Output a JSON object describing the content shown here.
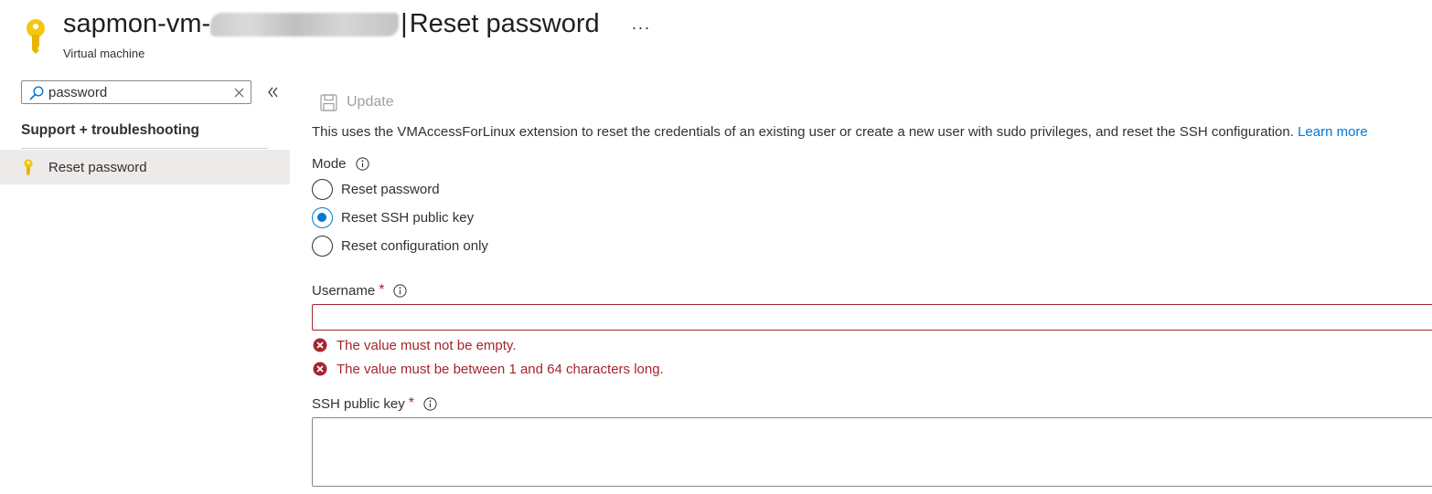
{
  "header": {
    "title_prefix": "sapmon-vm-",
    "title_separator": "|",
    "page_title": "Reset password",
    "subtitle": "Virtual machine",
    "more_label": "···"
  },
  "sidebar": {
    "search": {
      "value": "password",
      "placeholder": "Search"
    },
    "group_label": "Support + troubleshooting",
    "items": [
      {
        "label": "Reset password",
        "icon": "key-icon",
        "selected": true
      }
    ]
  },
  "toolbar": {
    "update_label": "Update"
  },
  "main": {
    "description": "This uses the VMAccessForLinux extension to reset the credentials of an existing user or create a new user with sudo privileges, and reset the SSH configuration.",
    "learn_more": "Learn more",
    "mode_label": "Mode",
    "mode_options": [
      {
        "label": "Reset password",
        "checked": false
      },
      {
        "label": "Reset SSH public key",
        "checked": true
      },
      {
        "label": "Reset configuration only",
        "checked": false
      }
    ],
    "username_label": "Username",
    "username_value": "",
    "required_marker": "*",
    "errors": [
      "The value must not be empty.",
      "The value must be between 1 and 64 characters long."
    ],
    "ssh_key_label": "SSH public key",
    "ssh_key_value": ""
  },
  "colors": {
    "accent": "#0078d4",
    "error": "#a4262c",
    "key_icon": "#f2c811",
    "selected_nav_bg": "#edebe9",
    "disabled_text": "#a19f9d"
  }
}
